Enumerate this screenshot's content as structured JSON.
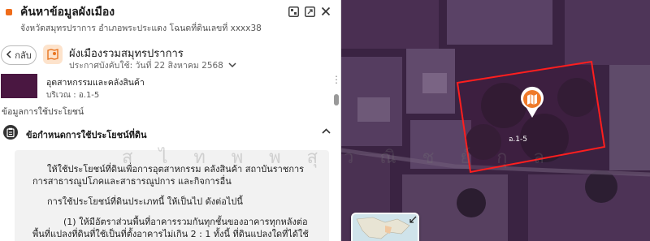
{
  "header": {
    "title": "ค้นหาข้อมูลผังเมือง",
    "subtitle": "จังหวัดสมุทรปราการ อำเภอพระประแดง โฉนดที่ดินเลขที่ xxxx38",
    "icons": [
      "layout-icon",
      "expand-icon",
      "close-icon"
    ]
  },
  "nav": {
    "back_label": "กลับ"
  },
  "plan": {
    "title": "ผังเมืองรวมสมุทรปราการ",
    "effective_date": "ประกาศบังคับใช้: วันที่ 22 สิงหาคม 2568"
  },
  "zone": {
    "color": "#4a1741",
    "name": "อุตสาหกรรมและคลังสินค้า",
    "code": "บริเวณ : อ.1-5"
  },
  "land_use_label": "ข้อมูลการใช้ประโยชน์",
  "regulations": {
    "title": "ข้อกำหนดการใช้ประโยชน์ที่ดิน",
    "para1": "ให้ใช้ประโยชน์ที่ดินเพื่อการอุตสาหกรรม คลังสินค้า สถาบันราชการ การสาธารณูปโภคและสาธารณูปการ และกิจการอื่น",
    "para2": "การใช้ประโยชน์ที่ดินประเภทนี้ ให้เป็นไป ดังต่อไปนี้",
    "para3": "(1) ให้มีอัตราส่วนพื้นที่อาคารรวมกันทุกชั้นของอาคารทุกหลังต่อพื้นที่แปลงที่ดินที่ใช้เป็นที่ตั้งอาคารไม่เกิน 2 : 1 ทั้งนี้ ที่ดินแปลงใดที่ได้ใช้ประโยชน์แล้ว หากมีการ"
  },
  "watermark": [
    "ส",
    "ไ",
    "ท",
    "พ",
    "พ",
    "สุ",
    "ว",
    "ณิ",
    "ช",
    "ย์",
    "กุ",
    "ล"
  ],
  "map": {
    "parcel_label": "อ.1-5",
    "parcel_outline_color": "#ff1e1e",
    "pin_color": "#ef7a2a"
  }
}
